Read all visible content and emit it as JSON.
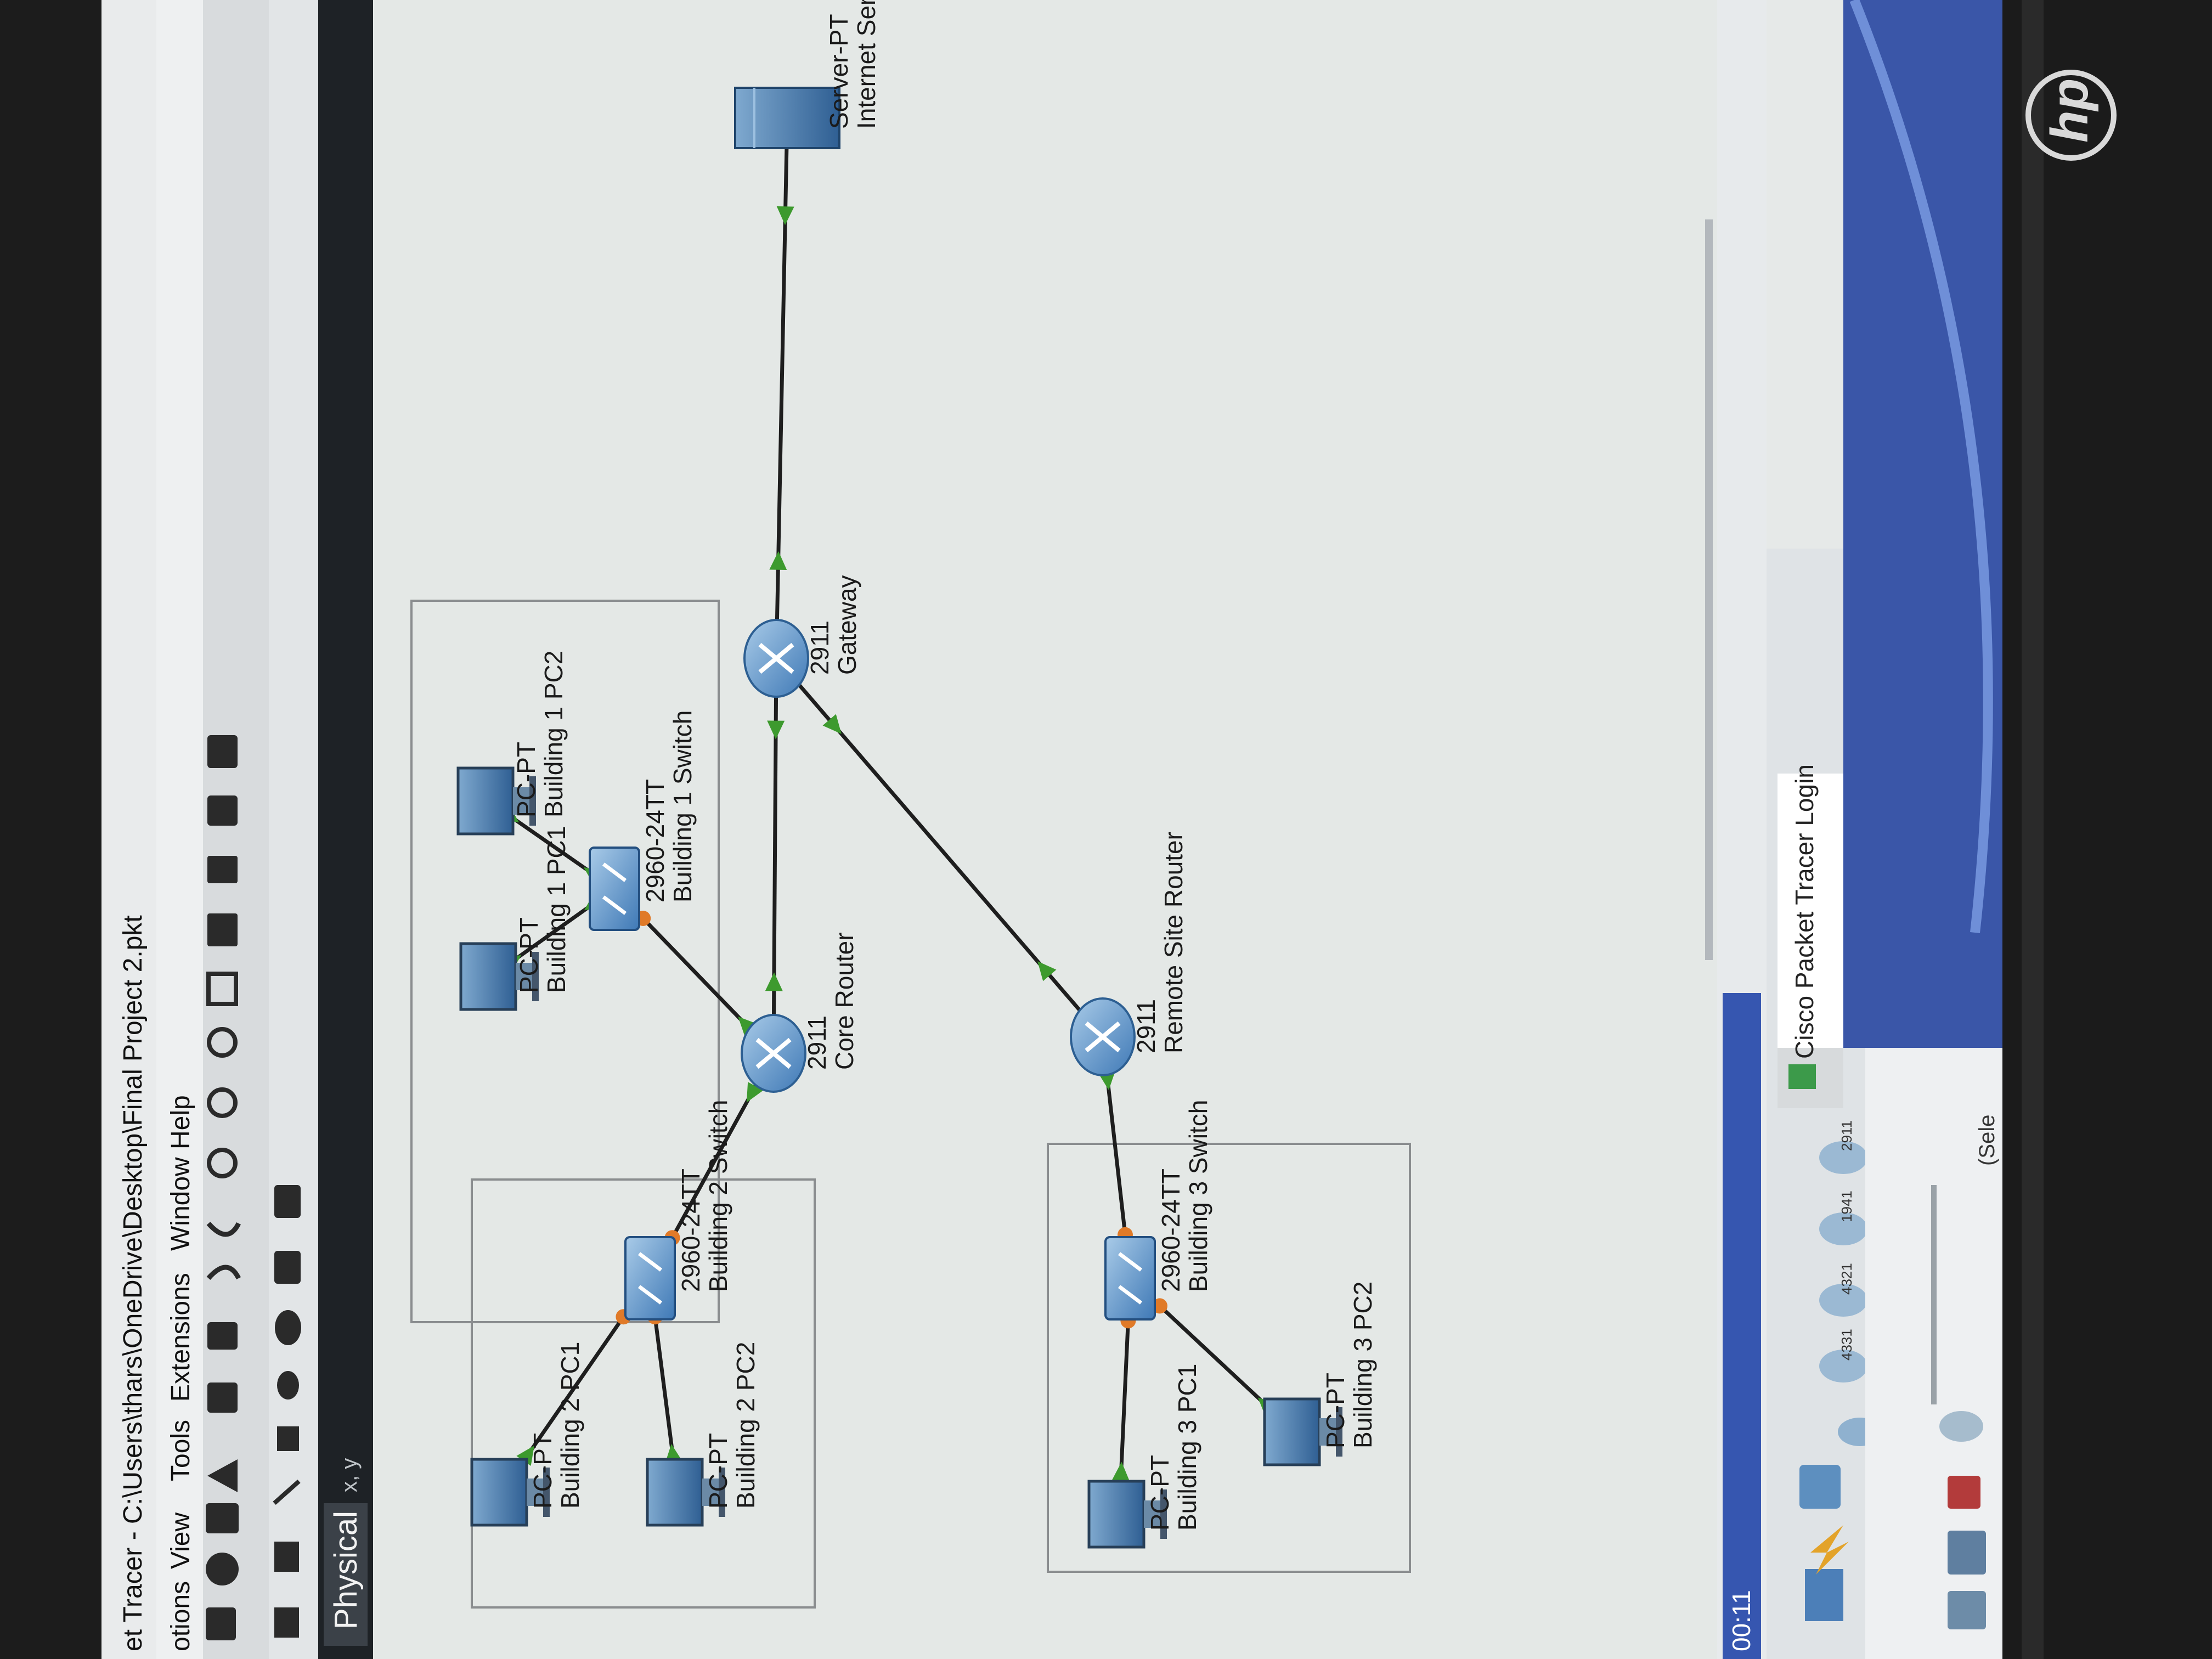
{
  "window": {
    "title": "et Tracer - C:\\Users\\thars\\OneDrive\\Desktop\\Final Project 2.pkt"
  },
  "menubar": {
    "items": [
      "otions",
      "View",
      "Tools",
      "Extensions",
      "Window",
      "Help"
    ]
  },
  "workspace": {
    "mode_label": "Physical",
    "coords_label": "x, y"
  },
  "devices": [
    {
      "key": "server",
      "model": "Server-PT",
      "name": "Internet Server",
      "icon": "server-icon"
    },
    {
      "key": "gateway",
      "model": "2911",
      "name": "Gateway",
      "icon": "router-icon"
    },
    {
      "key": "core",
      "model": "2911",
      "name": "Core Router",
      "icon": "router-icon"
    },
    {
      "key": "remote",
      "model": "2911",
      "name": "Remote Site Router",
      "icon": "router-icon"
    },
    {
      "key": "sw1",
      "model": "2960-24TT",
      "name": "Building 1 Switch",
      "icon": "switch-icon"
    },
    {
      "key": "sw2",
      "model": "2960-24TT",
      "name": "Building 2 Switch",
      "icon": "switch-icon"
    },
    {
      "key": "sw3",
      "model": "2960-24TT",
      "name": "Building 3 Switch",
      "icon": "switch-icon"
    },
    {
      "key": "b1pc1",
      "model": "PC-PT",
      "name": "Building 1 PC1",
      "icon": "pc-icon"
    },
    {
      "key": "b1pc2",
      "model": "PC-PT",
      "name": "Building 1 PC2",
      "icon": "pc-icon"
    },
    {
      "key": "b2pc1",
      "model": "PC-PT",
      "name": "Building 2 PC1",
      "icon": "pc-icon"
    },
    {
      "key": "b2pc2",
      "model": "PC-PT",
      "name": "Building 2 PC2",
      "icon": "pc-icon"
    },
    {
      "key": "b3pc1",
      "model": "PC-PT",
      "name": "Building 3 PC1",
      "icon": "pc-icon"
    },
    {
      "key": "b3pc2",
      "model": "PC-PT",
      "name": "Building 3 PC2",
      "icon": "pc-icon"
    }
  ],
  "links": [
    {
      "a": "gateway",
      "b": "server",
      "a_state": "up",
      "b_state": "up"
    },
    {
      "a": "core",
      "b": "gateway",
      "a_state": "up",
      "b_state": "up"
    },
    {
      "a": "remote",
      "b": "gateway",
      "a_state": "up",
      "b_state": "up"
    },
    {
      "a": "sw1",
      "b": "core",
      "a_state": "pending",
      "b_state": "up"
    },
    {
      "a": "sw2",
      "b": "core",
      "a_state": "pending",
      "b_state": "up"
    },
    {
      "a": "sw3",
      "b": "remote",
      "a_state": "pending",
      "b_state": "up"
    },
    {
      "a": "b1pc1",
      "b": "sw1",
      "a_state": "up",
      "b_state": "up"
    },
    {
      "a": "b1pc2",
      "b": "sw1",
      "a_state": "up",
      "b_state": "up"
    },
    {
      "a": "b2pc1",
      "b": "sw2",
      "a_state": "up",
      "b_state": "pending"
    },
    {
      "a": "b2pc2",
      "b": "sw2",
      "a_state": "up",
      "b_state": "pending"
    },
    {
      "a": "b3pc1",
      "b": "sw3",
      "a_state": "up",
      "b_state": "pending"
    },
    {
      "a": "b3pc2",
      "b": "sw3",
      "a_state": "up",
      "b_state": "pending"
    }
  ],
  "status_bar": {
    "time": "00:11"
  },
  "device_palette": {
    "models": [
      "4331",
      "4321",
      "1941",
      "2911"
    ],
    "select_hint": "(Sele"
  },
  "popup": {
    "title": "Cisco Packet Tracer Login"
  },
  "bezel": {
    "logo": "hp"
  },
  "colors": {
    "workspace_bg": "#e4e8e6",
    "toolbar_bg": "#d9dcde",
    "link_up": "#3d9a2e",
    "link_pending": "#e07a28",
    "link_down": "#d8382c",
    "router_blue": "#4f8dc7",
    "popup_blue": "#3a56a8"
  }
}
